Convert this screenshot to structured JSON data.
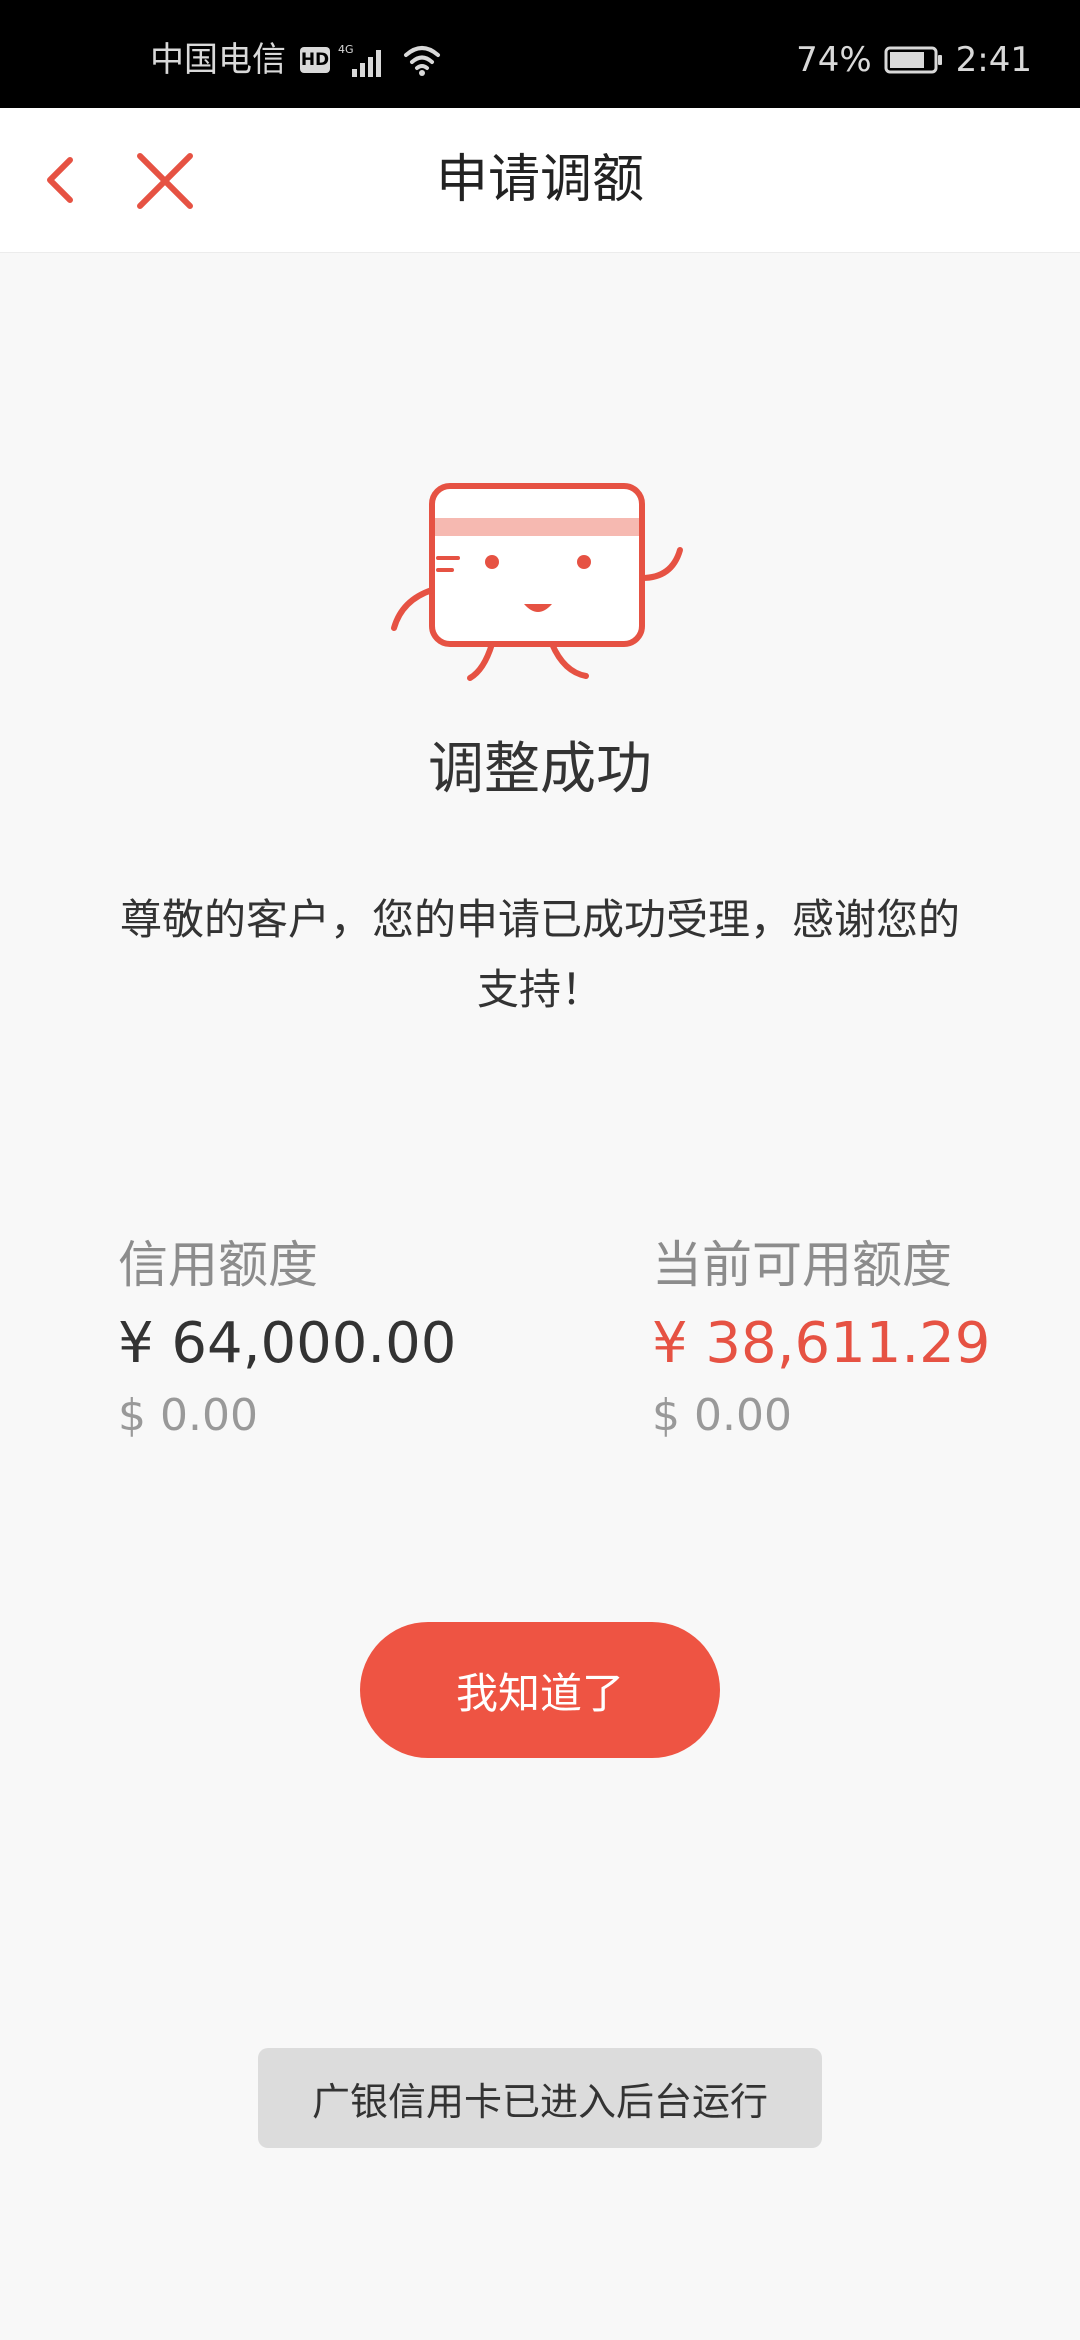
{
  "status_bar": {
    "carrier": "中国电信",
    "hd_badge": "HD",
    "network": "4G",
    "battery": "74%",
    "time": "2:41"
  },
  "nav": {
    "title": "申请调额",
    "back_icon": "chevron-left-icon",
    "close_icon": "close-icon"
  },
  "result": {
    "title": "调整成功",
    "message": "尊敬的客户，您的申请已成功受理，感谢您的支持！"
  },
  "limits": {
    "credit_limit": {
      "label": "信用额度",
      "cny": "¥ 64,000.00",
      "usd": "$ 0.00"
    },
    "available_limit": {
      "label": "当前可用额度",
      "cny": "¥ 38,611.29",
      "usd": "$ 0.00"
    }
  },
  "button": {
    "label": "我知道了"
  },
  "toast": {
    "text": "广银信用卡已进入后台运行"
  },
  "colors": {
    "accent": "#ee5443",
    "background": "#f8f8f8",
    "status_bar": "#000000"
  }
}
